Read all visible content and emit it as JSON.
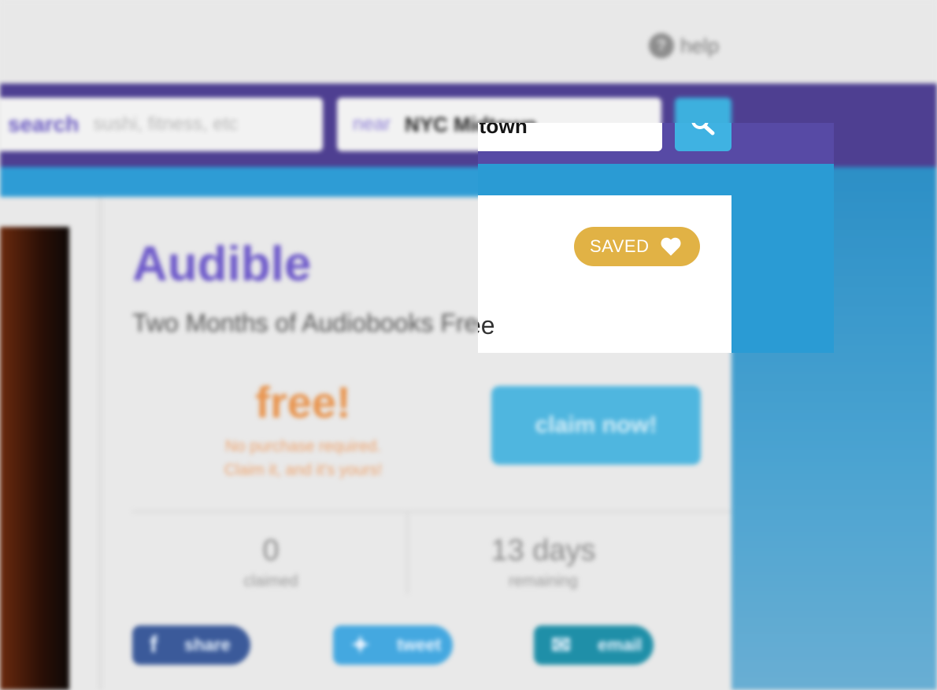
{
  "header": {
    "help_label": "help",
    "help_icon_glyph": "?"
  },
  "search": {
    "search_label": "search",
    "search_placeholder": "sushi, fitness, etc",
    "near_label": "near",
    "near_value": "NYC Midtown",
    "near_value_visible": "idtown"
  },
  "deal": {
    "title": "Audible",
    "subtitle": "Two Months of Audiobooks Free",
    "subtitle_visible": "ee",
    "price": "free!",
    "price_note_line1": "No purchase required.",
    "price_note_line2": "Claim it, and it's yours!",
    "claim_label": "claim now!",
    "saved_label": "SAVED",
    "stats": [
      {
        "value": "0",
        "caption": "claimed"
      },
      {
        "value": "13 days",
        "caption": "remaining"
      }
    ],
    "share": [
      {
        "label": "share",
        "icon": "facebook-icon",
        "glyph": "f",
        "color": "#3b5a9a"
      },
      {
        "label": "tweet",
        "icon": "twitter-icon",
        "glyph": "✦",
        "color": "#44a8e0"
      },
      {
        "label": "email",
        "icon": "email-icon",
        "glyph": "✉",
        "color": "#1f8fa8"
      }
    ]
  },
  "colors": {
    "purple": "#574aa5",
    "blue": "#2a9bd4",
    "saved_gold": "#e1b245",
    "title_purple": "#6d59c9",
    "price_orange": "#e8944e"
  }
}
